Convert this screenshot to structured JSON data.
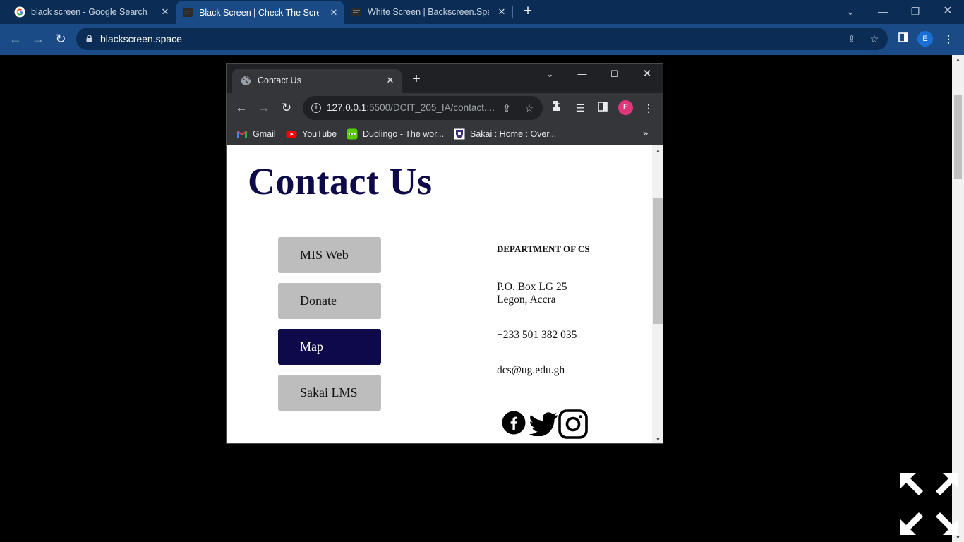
{
  "outer_browser": {
    "tabs": [
      {
        "title": "black screen - Google Search",
        "favicon": "google-g-icon"
      },
      {
        "title": "Black Screen | Check The Screen",
        "favicon": "screen-site-icon",
        "active": true
      },
      {
        "title": "White Screen | Backscreen.Space",
        "favicon": "screen-site-icon"
      }
    ],
    "address": "blackscreen.space",
    "profile_initial": "E",
    "colors": {
      "frame": "#0b2d55",
      "toolbar": "#1a4b86"
    }
  },
  "inner_browser": {
    "tab_title": "Contact Us",
    "url_host": "127.0.0.1",
    "url_rest": ":5500/DCIT_205_IA/contact....",
    "profile_initial": "E",
    "bookmarks": [
      {
        "label": "Gmail",
        "icon": "gmail-icon"
      },
      {
        "label": "YouTube",
        "icon": "youtube-icon"
      },
      {
        "label": "Duolingo - The wor...",
        "icon": "duolingo-icon"
      },
      {
        "label": "Sakai : Home : Over...",
        "icon": "sakai-icon"
      }
    ],
    "bookmarks_more": "»"
  },
  "page": {
    "title": "Contact Us",
    "nav_buttons": [
      {
        "label": "MIS Web",
        "active": false
      },
      {
        "label": "Donate",
        "active": false
      },
      {
        "label": "Map",
        "active": true
      },
      {
        "label": "Sakai LMS",
        "active": false
      }
    ],
    "contact": {
      "department": "DEPARTMENT OF CS",
      "address_line1": "P.O. Box LG 25",
      "address_line2": "Legon, Accra",
      "phone": "+233 501 382 035",
      "email": "dcs@ug.edu.gh"
    },
    "social_icons": [
      "facebook-icon",
      "twitter-icon",
      "instagram-icon"
    ],
    "colors": {
      "accent": "#0e0a4a",
      "button": "#bdbdbd"
    }
  }
}
